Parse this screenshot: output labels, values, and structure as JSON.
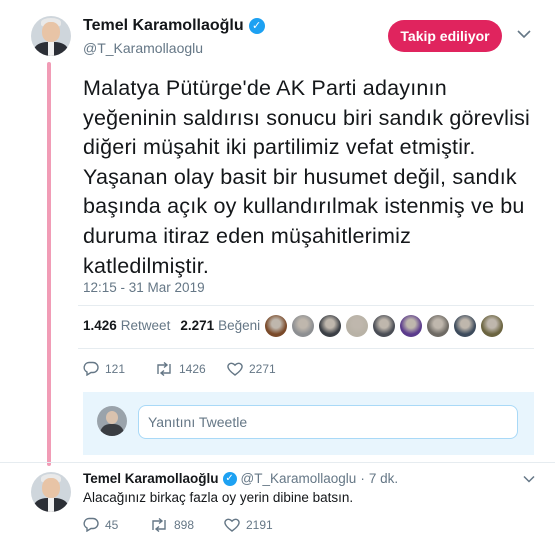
{
  "tweet": {
    "author_name": "Temel Karamollaoğlu",
    "author_handle": "@T_Karamollaoglu",
    "verified_glyph": "✓",
    "follow_button": "Takip ediliyor",
    "text": "Malatya Pütürge'de AK Parti adayının yeğeninin saldırısı sonucu biri sandık görevlisi diğeri müşahit iki partilimiz vefat etmiştir. Yaşanan olay basit bir husumet değil, sandık başında açık oy kullandırılmak istenmiş ve bu duruma itiraz eden müşahitlerimiz katledilmiştir.",
    "timestamp": "12:15 - 31 Mar 2019",
    "retweet_count": "1.426",
    "retweet_label": "Retweet",
    "like_count": "2.271",
    "like_label": "Beğeni",
    "likers": [
      "#7a4a2a",
      "#8d8f92",
      "#3b3f45",
      "#b8b2a6",
      "#4a4d55",
      "#5b3b8c",
      "#6e6a64",
      "#3d4b5c",
      "#6b6440"
    ],
    "actions": {
      "replies": "121",
      "retweets": "1426",
      "likes": "2271"
    }
  },
  "reply_box": {
    "placeholder": "Yanıtını Tweetle"
  },
  "reply_tweet": {
    "author_name": "Temel Karamollaoğlu",
    "author_handle": "@T_Karamollaoglu",
    "separator": "·",
    "time": "7 dk.",
    "text": "Alacağınız birkaç fazla oy yerin dibine batsın.",
    "actions": {
      "replies": "45",
      "retweets": "898",
      "likes": "2191"
    }
  },
  "colors": {
    "accent": "#e0245e",
    "verified": "#1da1f2",
    "muted": "#657786"
  }
}
